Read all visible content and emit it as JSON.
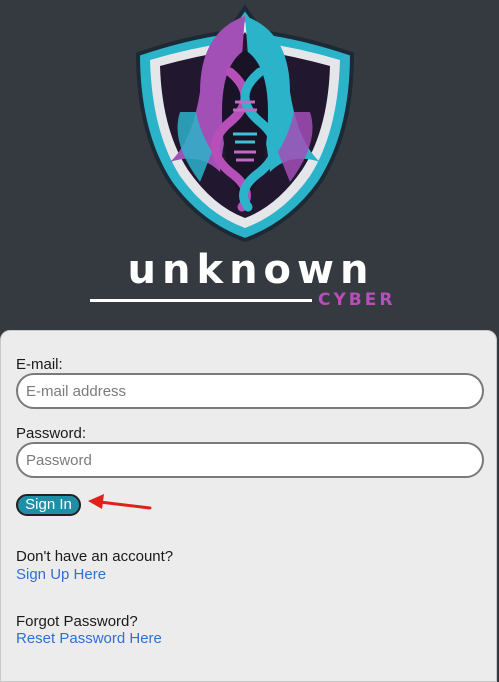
{
  "brand": {
    "title": "UNKNOWN",
    "subtitle": "CYBER",
    "logo_icon": "hooded-dna-shield-logo",
    "colors": {
      "background": "#353a40",
      "magenta": "#b64fb7",
      "cyan": "#2bb3c9"
    }
  },
  "form": {
    "email_label": "E-mail:",
    "email_placeholder": "E-mail address",
    "email_value": "",
    "password_label": "Password:",
    "password_placeholder": "Password",
    "password_value": "",
    "signin_label": "Sign In",
    "signin_color": "#1f8fa8",
    "annotation_icon": "red-arrow-icon"
  },
  "links": {
    "signup_prompt": "Don't have an account?",
    "signup_link": "Sign Up Here",
    "forgot_prompt": "Forgot Password?",
    "reset_link": "Reset Password Here",
    "link_color": "#2f6fd6"
  }
}
